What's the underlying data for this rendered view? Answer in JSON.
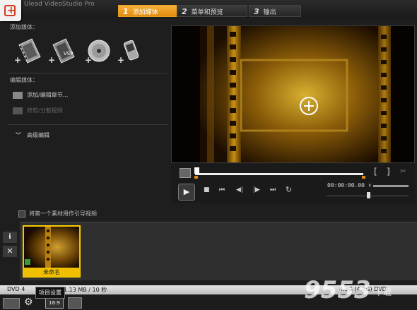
{
  "app": {
    "title": "Ulead VideoStudio Pro"
  },
  "steps": [
    {
      "num": "1",
      "label": "添加媒体"
    },
    {
      "num": "2",
      "label": "菜单和预览"
    },
    {
      "num": "3",
      "label": "输出"
    }
  ],
  "left": {
    "add_media_label": "添加媒体：",
    "media_buttons": [
      "add-video",
      "add-vsp-project",
      "add-disc",
      "add-mobile-device"
    ],
    "edit_media_label": "编辑媒体：",
    "edit_chapters": "添加/编辑章节...",
    "trim_split": "修剪/分割视频",
    "advanced_edit": "高级编辑"
  },
  "player": {
    "timecode": "00:00:00",
    "frame_suffix": "00",
    "trim_in": "[",
    "trim_out": "]"
  },
  "intro_checkbox": "将第一个素材用作引导视频",
  "clip": {
    "name": "未命名"
  },
  "status": {
    "disc": "DVD 4",
    "size": "1.13 MB / 10 秒",
    "right": "4.3G (4.7G) DVD"
  },
  "tooltip": "项目设置",
  "aspect_badge": "16:9",
  "watermark": {
    "text": "9553",
    "sub": "下载"
  },
  "colors": {
    "accent": "#f0a020",
    "clip_label_bg": "#ffcc00"
  }
}
